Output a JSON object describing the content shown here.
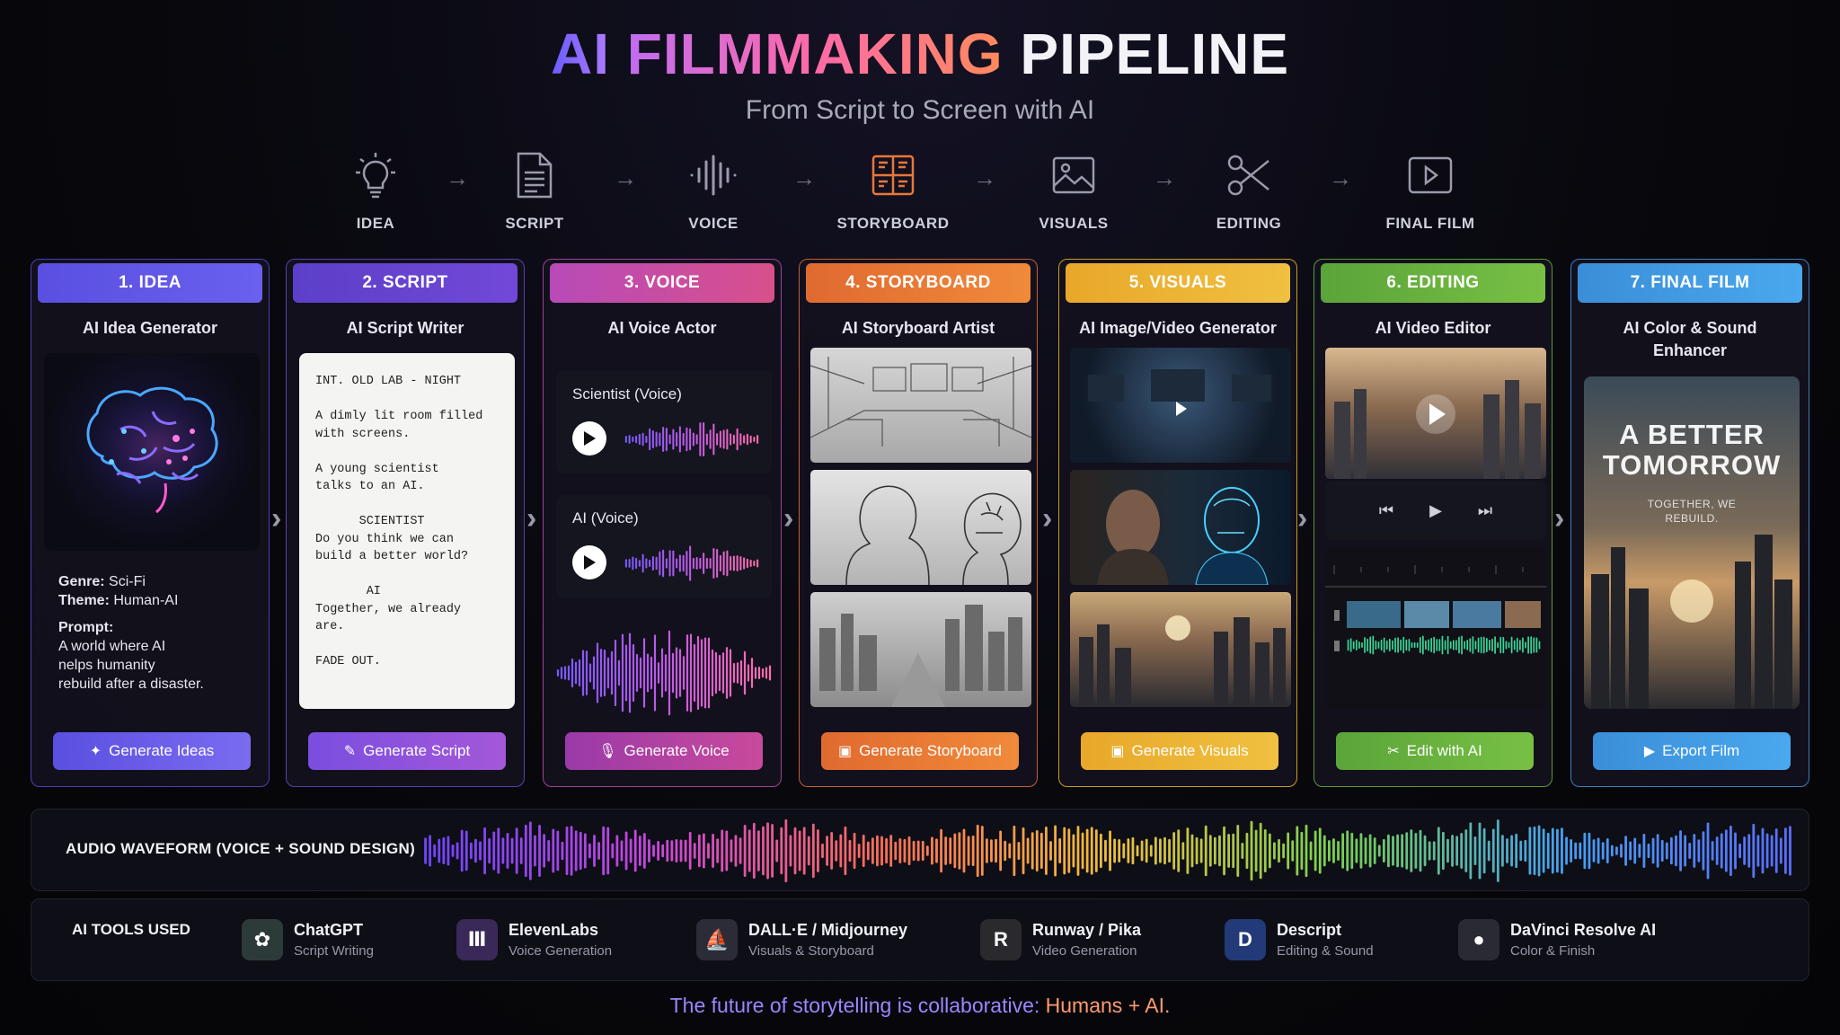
{
  "header": {
    "title_ai": "AI",
    "title_filmmaking": "FILMMAKING",
    "title_pipeline": "PIPELINE",
    "subtitle": "From Script to Screen with AI"
  },
  "flow": {
    "steps": [
      {
        "label": "IDEA",
        "icon": "lightbulb-icon"
      },
      {
        "label": "SCRIPT",
        "icon": "document-icon"
      },
      {
        "label": "VOICE",
        "icon": "audio-wave-icon"
      },
      {
        "label": "STORYBOARD",
        "icon": "storyboard-icon"
      },
      {
        "label": "VISUALS",
        "icon": "image-icon"
      },
      {
        "label": "EDITING",
        "icon": "scissors-icon"
      },
      {
        "label": "FINAL FILM",
        "icon": "play-screen-icon"
      }
    ],
    "arrow": "→"
  },
  "cards": [
    {
      "head": "1. IDEA",
      "sub": "AI Idea Generator",
      "button": "Generate Ideas",
      "color": "#5b4fe0",
      "button_icon": "sparkle-icon"
    },
    {
      "head": "2. SCRIPT",
      "sub": "AI Script Writer",
      "button": "Generate Script",
      "color": "#7a4ee0",
      "button_icon": "pencil-icon"
    },
    {
      "head": "3. VOICE",
      "sub": "AI Voice Actor",
      "button": "Generate Voice",
      "color": "#b84ab8",
      "button_icon": "microphone-icon"
    },
    {
      "head": "4. STORYBOARD",
      "sub": "AI Storyboard Artist",
      "button": "Generate Storyboard",
      "color": "#e8773a",
      "button_icon": "image-icon"
    },
    {
      "head": "5. VISUALS",
      "sub": "AI Image/Video Generator",
      "button": "Generate Visuals",
      "color": "#e8b02c",
      "button_icon": "image-icon"
    },
    {
      "head": "6. EDITING",
      "sub": "AI Video Editor",
      "button": "Edit with AI",
      "color": "#6cb43a",
      "button_icon": "scissors-icon"
    },
    {
      "head": "7. FINAL FILM",
      "sub_line1": "AI Color & Sound",
      "sub_line2": "Enhancer",
      "button": "Export Film",
      "color": "#3a90d8",
      "button_icon": "play-icon"
    }
  ],
  "idea": {
    "genre_label": "Genre:",
    "genre": "Sci-Fi",
    "theme_label": "Theme:",
    "theme": "Human-AI",
    "prompt_label": "Prompt:",
    "prompt_l1": "A world where AI",
    "prompt_l2": "nelps humanity",
    "prompt_l3": "rebuild after a disaster."
  },
  "script": {
    "text": "INT. OLD LAB - NIGHT\n\nA dimly lit room filled\nwith screens.\n\nA young scientist\ntalks to an AI.\n\n      SCIENTIST\nDo you think we can\nbuild a better world?\n\n       AI\nTogether, we already\nare.\n\nFADE OUT."
  },
  "voice": {
    "track1": "Scientist (Voice)",
    "track2": "AI (Voice)"
  },
  "final_film": {
    "poster_title_l1": "A BETTER",
    "poster_title_l2": "TOMORROW",
    "poster_tag_l1": "TOGETHER, WE",
    "poster_tag_l2": "REBUILD."
  },
  "waveform": {
    "label": "AUDIO WAVEFORM (VOICE + SOUND DESIGN)"
  },
  "tools": {
    "label": "AI TOOLS USED",
    "items": [
      {
        "name": "ChatGPT",
        "desc": "Script Writing",
        "icon": "chatgpt-icon",
        "glyph": "✿",
        "color": "#2c3b3a"
      },
      {
        "name": "ElevenLabs",
        "desc": "Voice Generation",
        "icon": "elevenlabs-icon",
        "glyph": "Ⅲ",
        "color": "#3a2858"
      },
      {
        "name": "DALL·E / Midjourney",
        "desc": "Visuals & Storyboard",
        "icon": "midjourney-icon",
        "glyph": "⛵",
        "color": "#2c2c38"
      },
      {
        "name": "Runway / Pika",
        "desc": "Video Generation",
        "icon": "runway-icon",
        "glyph": "R",
        "color": "#2a2a2e"
      },
      {
        "name": "Descript",
        "desc": "Editing & Sound",
        "icon": "descript-icon",
        "glyph": "D",
        "color": "#233a78"
      },
      {
        "name": "DaVinci Resolve AI",
        "desc": "Color & Finish",
        "icon": "davinci-icon",
        "glyph": "●",
        "color": "#2a2a34"
      }
    ]
  },
  "footer": {
    "part1": "The future of storytelling is collaborative:",
    "part2": "Humans + AI."
  }
}
